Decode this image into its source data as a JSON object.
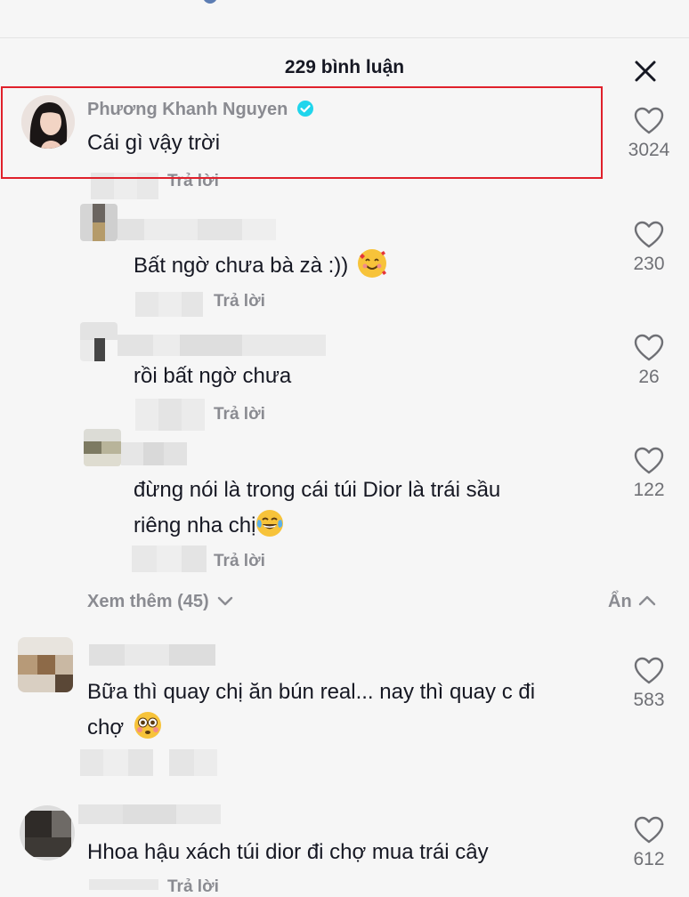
{
  "header": {
    "title": "229 bình luận"
  },
  "comments": [
    {
      "name": "Phương Khanh Nguyen",
      "text": "Cái gì vậy trời",
      "reply_label": "Trả lời",
      "likes": "3024"
    },
    {
      "text": "Bất ngờ chưa bà zà :))",
      "reply_label": "Trả lời",
      "likes": "230"
    },
    {
      "text": "rồi bất ngờ chưa",
      "reply_label": "Trả lời",
      "likes": "26"
    },
    {
      "text_line1": "đừng nói là trong cái túi Dior là trái sầu",
      "text_line2": "riêng nha chị",
      "reply_label": "Trả lời",
      "likes": "122"
    },
    {
      "text_line1": "Bữa thì quay chị ăn bún real... nay thì quay c đi",
      "text_line2": "chợ",
      "likes": "583"
    },
    {
      "text": "Hhoa hậu xách túi dior đi chợ mua trái cây",
      "reply_label": "Trả lời",
      "likes": "612"
    }
  ],
  "see_more": {
    "label": "Xem thêm (45)"
  },
  "hide": {
    "label": "Ẩn"
  },
  "icons": {
    "close": "close-icon",
    "heart": "heart-outline-icon",
    "verified": "verified-badge-icon",
    "chevron_down": "chevron-down-icon",
    "chevron_up": "chevron-up-icon"
  },
  "colors": {
    "highlight": "#e0202b",
    "verified": "#20d5ec",
    "muted": "#8a8b91"
  }
}
